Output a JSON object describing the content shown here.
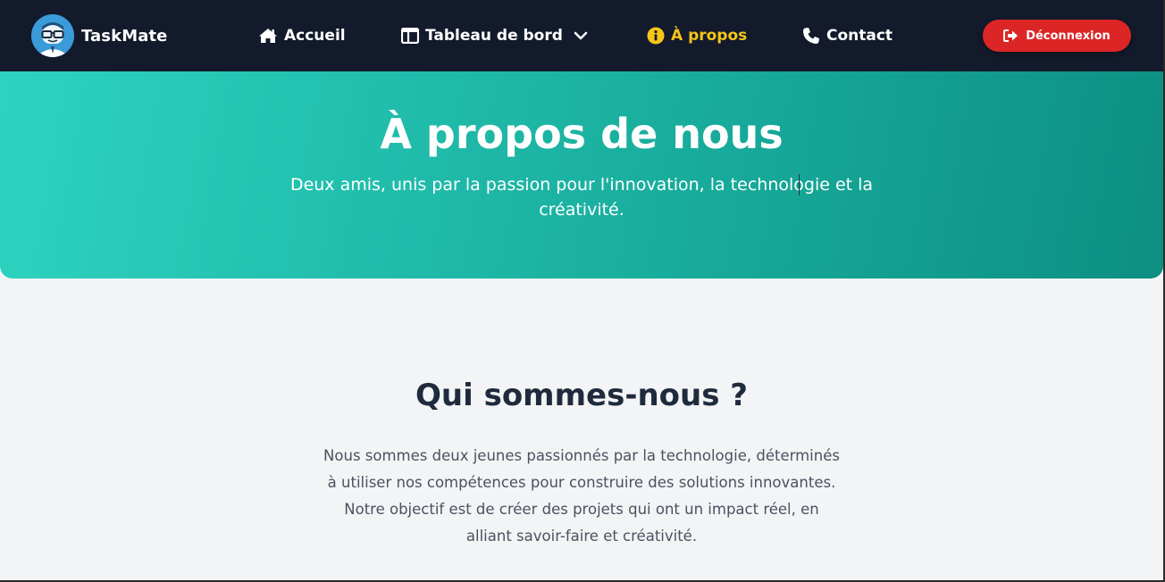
{
  "brand": {
    "name": "TaskMate",
    "logo_icon": "robot-glasses-logo"
  },
  "nav": {
    "items": [
      {
        "label": "Accueil",
        "icon": "home-icon",
        "active": false
      },
      {
        "label": "Tableau de bord",
        "icon": "dashboard-icon",
        "active": false,
        "has_dropdown": true
      },
      {
        "label": "À propos",
        "icon": "info-icon",
        "active": true
      },
      {
        "label": "Contact",
        "icon": "phone-icon",
        "active": false
      }
    ],
    "logout_label": "Déconnexion"
  },
  "hero": {
    "title": "À propos de nous",
    "subtitle": "Deux amis, unis par la passion pour l'innovation, la technologie et la créativité."
  },
  "about": {
    "title": "Qui sommes-nous ?",
    "text": "Nous sommes deux jeunes passionnés par la technologie, déterminés à utiliser nos compétences pour construire des solutions innovantes. Notre objectif est de créer des projets qui ont un impact réel, en alliant savoir-faire et créativité."
  },
  "colors": {
    "navbar_bg": "#121a2b",
    "accent_active": "#f5c518",
    "logout_bg": "#dc2626",
    "hero_gradient_start": "#2ed4c0",
    "hero_gradient_end": "#0d8f82",
    "page_bg": "#f3f4f6"
  }
}
